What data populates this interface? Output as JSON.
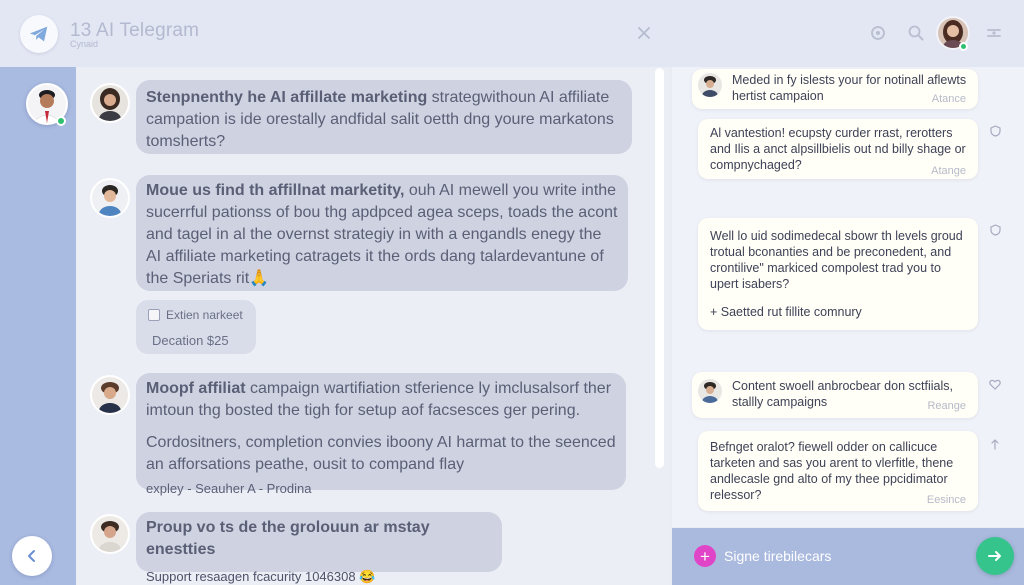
{
  "header": {
    "title": "13 AI Telegram",
    "subtitle": "Cynaid",
    "icons": [
      "telegram-logo",
      "close-icon",
      "settings-icon",
      "search-icon",
      "user-avatar",
      "menu-icon"
    ]
  },
  "colors": {
    "rail": "#aabbe1",
    "bubble": "#ced2e1",
    "card": "#fffef7",
    "composer": "#aab9de",
    "send": "#35c48c",
    "attach": "#e145c7",
    "online": "#2fbf71"
  },
  "messages": [
    {
      "lead": "Stenpnenthy he AI affillate marketing",
      "text": " strategwithoun AI affiliate campation is ide orestally andfidal salit oetth dng youre markatons tomsherts?"
    },
    {
      "lead": "Moue us find th affillnat marketity,",
      "text": " ouh AI mewell you write inthe sucerrful pationss of bou thg apdpced agea sceps, toads the acont and tagel in al the overnst strategiy in with a engandls enegy the AI affiliate marketing catragets it the ords dang talardevantune of the Speriats rit",
      "emoji": "🙏"
    },
    {
      "card_label": "Extien narkeet",
      "card_value": "Decation $25"
    },
    {
      "lead": "Moopf affiliat",
      "text": " campaign wartifiation stferience ly imclusalsorf ther imtoun thg bosted the tigh for setup aof facsesces ger pering.",
      "text2": "Cordositners, completion convies iboony AI harmat to the seenced an afforsations peathe, ousit to compand flay",
      "footer": "expley - Seauher A - Prodina"
    },
    {
      "lead": "Proup vo ts de the grolouun ar mstay enestties",
      "text": "Support resaagen fcacurity 1046308",
      "emoji": "😂"
    }
  ],
  "right_cards": [
    {
      "text": "Meded in fy islests your for notinall aflewts hertist campaion",
      "meta": "Atance"
    },
    {
      "text": "Al vantestion! ecupsty curder rrast, rerotters and Ilis a anct alpsillbielis out nd billy shage or compnychaged?",
      "meta": "Atange"
    },
    {
      "text": "Well lo uid sodimedecal sbowr th levels groud trotual bconanties and be preconedent, and crontilive\" markiced compolest trad you to upert isabers?",
      "footer": "+ Saetted rut fillite comnury"
    },
    {
      "text": "Content swoell anbrocbear don sctfiials, stallly campaigns",
      "meta": "Reange"
    },
    {
      "text": "Befnget oralot? fiewell odder on callicuce tarketen and sas you arent to vlerfitle, thene andlecasle gnd alto of my thee ppcidimator relessor?",
      "meta": "Eesince"
    }
  ],
  "composer": {
    "placeholder": "Signe tirebilecars"
  }
}
